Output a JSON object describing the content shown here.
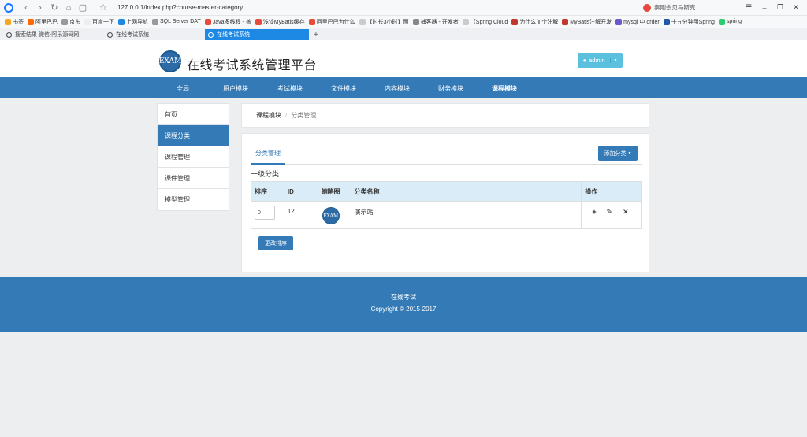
{
  "browser": {
    "url": "127.0.0.1/index.php?course-master-category",
    "search_hint": "秦刚会见马斯克",
    "bookmarks": [
      "书签",
      "阿里巴巴",
      "京东",
      "百度一下",
      "上网导航",
      "SQL Server DAT",
      "Java多线程 - 善",
      "浅谈MyBatis缓存",
      "阿里巴巴为什么",
      "【时长3小时】面",
      "捕客器 - 开发者",
      "【Spring Cloud",
      "为什么加个注解",
      "MyBatis注解开发",
      "mysql 中 order",
      "十五分钟用Spring",
      "spring"
    ],
    "tabs": [
      {
        "label": "搜索结果 微信-阿乐源码网"
      },
      {
        "label": "在线考试系统"
      },
      {
        "label": "在线考试系统"
      }
    ]
  },
  "header": {
    "logo_text": "EXAM",
    "title": "在线考试系统管理平台",
    "user_label": "admin"
  },
  "nav": [
    {
      "label": "全局"
    },
    {
      "label": "用户模块"
    },
    {
      "label": "考试模块"
    },
    {
      "label": "文件模块"
    },
    {
      "label": "内容模块"
    },
    {
      "label": "财务模块"
    },
    {
      "label": "课程模块"
    }
  ],
  "sidebar": [
    {
      "label": "首页"
    },
    {
      "label": "课程分类"
    },
    {
      "label": "课程管理"
    },
    {
      "label": "课件管理"
    },
    {
      "label": "模型管理"
    }
  ],
  "breadcrumb": {
    "parent": "课程模块",
    "sep": "/",
    "current": "分类管理"
  },
  "panel": {
    "tab_label": "分类管理",
    "add_label": "添加分类",
    "section_title": "一级分类",
    "columns": [
      "排序",
      "ID",
      "缩略图",
      "分类名称",
      "操作"
    ],
    "rows": [
      {
        "sort": "0",
        "id": "12",
        "thumb_text": "EXAM",
        "name": "演示站"
      }
    ],
    "reorder_label": "更改排序"
  },
  "footer": {
    "line1": "在线考试",
    "line2": "Copyright © 2015-2017"
  },
  "colors": {
    "primary": "#337ab7",
    "info": "#5bc0de",
    "table_head": "#d9ecf7"
  }
}
